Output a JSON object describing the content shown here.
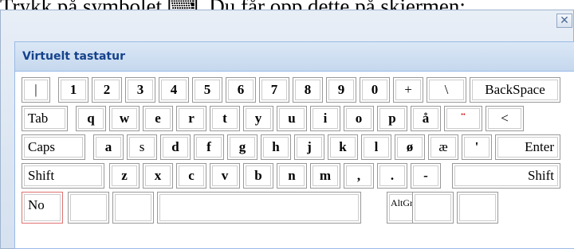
{
  "caption": "Trykk på symbolet ⌨. Du får opp dette på skjermen:",
  "window": {
    "close_icon": "✕"
  },
  "keyboard": {
    "title": "Virtuelt tastatur",
    "row1": [
      "|",
      "1",
      "2",
      "3",
      "4",
      "5",
      "6",
      "7",
      "8",
      "9",
      "0",
      "+",
      "\\",
      "BackSpace"
    ],
    "row2": [
      "Tab",
      "q",
      "w",
      "e",
      "r",
      "t",
      "y",
      "u",
      "i",
      "o",
      "p",
      "å",
      "¨",
      "<"
    ],
    "row3": [
      "Caps",
      "a",
      "s",
      "d",
      "f",
      "g",
      "h",
      "j",
      "k",
      "l",
      "ø",
      "æ",
      "'",
      "Enter"
    ],
    "row4": [
      "Shift",
      "z",
      "x",
      "c",
      "v",
      "b",
      "n",
      "m",
      ",",
      ".",
      "-",
      "Shift"
    ],
    "row5": [
      "No",
      "",
      "",
      "",
      "AltGr",
      "",
      ""
    ]
  }
}
